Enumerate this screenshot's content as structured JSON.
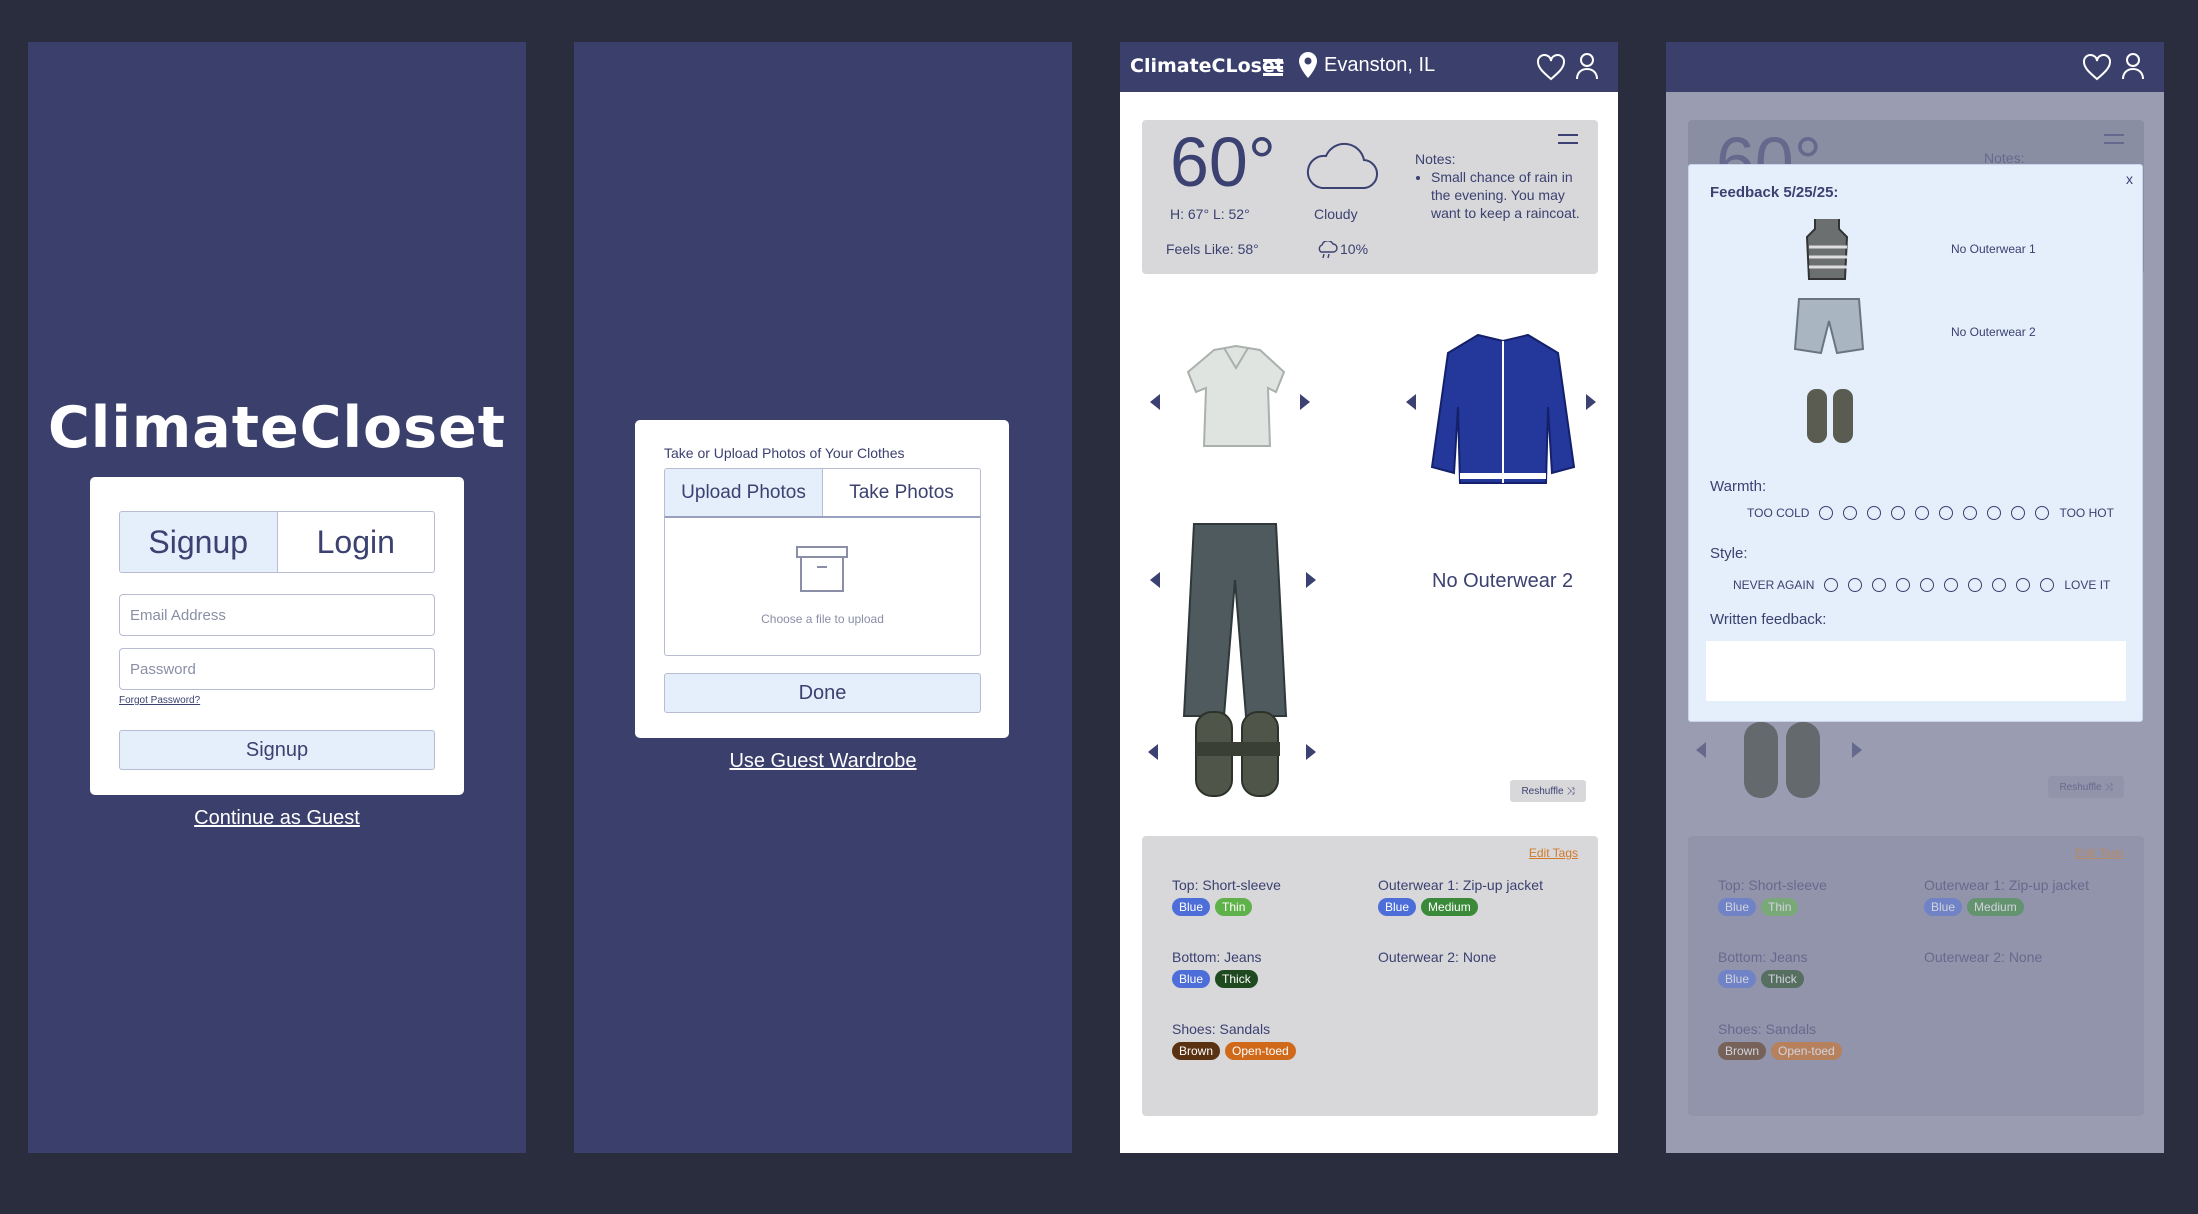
{
  "login": {
    "brand": "ClimateCloset",
    "tab_signup": "Signup",
    "tab_login": "Login",
    "email_placeholder": "Email Address",
    "password_placeholder": "Password",
    "forgot": "Forgot Password?",
    "submit": "Signup",
    "guest": "Continue as Guest"
  },
  "upload": {
    "title": "Take or Upload Photos of Your Clothes",
    "tab_upload": "Upload Photos",
    "tab_take": "Take Photos",
    "drop_label": "Choose a file to upload",
    "done": "Done",
    "guest_wardrobe": "Use Guest Wardrobe"
  },
  "header": {
    "brand": "ClimateCLoset",
    "location": "Evanston, IL"
  },
  "weather": {
    "temp": "60°",
    "hilo": "H: 67° L: 52°",
    "condition": "Cloudy",
    "feels": "Feels Like: 58°",
    "precip": "10%",
    "notes_title": "Notes:",
    "note": "Small chance of rain in the evening. You may want to keep a raincoat."
  },
  "outfit": {
    "no_outerwear_2": "No Outerwear 2",
    "reshuffle": "Reshuffle"
  },
  "tags": {
    "edit": "Edit Tags",
    "top": "Top: Short-sleeve",
    "top_chips": [
      "Blue",
      "Thin"
    ],
    "outer1": "Outerwear 1: Zip-up jacket",
    "outer1_chips": [
      "Blue",
      "Medium"
    ],
    "bottom": "Bottom: Jeans",
    "bottom_chips": [
      "Blue",
      "Thick"
    ],
    "outer2": "Outerwear 2: None",
    "shoes": "Shoes: Sandals",
    "shoes_chips": [
      "Brown",
      "Open-toed"
    ]
  },
  "feedback": {
    "title": "Feedback 5/25/25:",
    "close": "x",
    "no_outer1": "No Outerwear 1",
    "no_outer2": "No Outerwear 2",
    "warmth_label": "Warmth:",
    "warmth_low": "TOO COLD",
    "warmth_high": "TOO HOT",
    "style_label": "Style:",
    "style_low": "NEVER AGAIN",
    "style_high": "LOVE IT",
    "written_label": "Written feedback:",
    "peek_temp": "60°",
    "peek_notes": "Notes:"
  }
}
